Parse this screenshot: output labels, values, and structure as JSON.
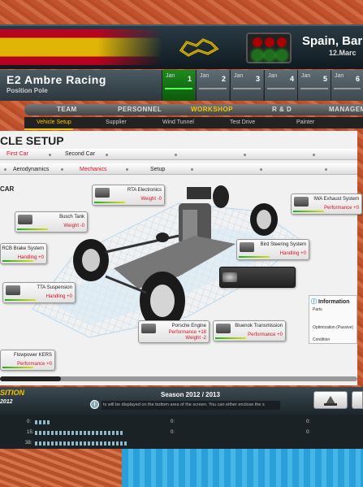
{
  "header": {
    "country": "Spain, Bar",
    "date": "12.Marc"
  },
  "team": {
    "name": "E2 Ambre Racing",
    "position": "Position Pole"
  },
  "calendar": [
    {
      "month": "Jan",
      "num": "1",
      "active": true
    },
    {
      "month": "Jan",
      "num": "2",
      "active": false
    },
    {
      "month": "Jan",
      "num": "3",
      "active": false
    },
    {
      "month": "Jan",
      "num": "4",
      "active": false
    },
    {
      "month": "Jan",
      "num": "5",
      "active": false
    },
    {
      "month": "Jan",
      "num": "6",
      "active": false
    }
  ],
  "nav": {
    "items": [
      "TEAM",
      "PERSONNEL",
      "WORKSHOP",
      "R & D",
      "MANAGEM"
    ],
    "active": "WORKSHOP"
  },
  "subnav": {
    "items": [
      "Vehicle Setup",
      "Supplier",
      "Wind Tunnel",
      "Test Drive",
      "Painter"
    ],
    "active": "Vehicle Setup"
  },
  "page": {
    "title": "CLE SETUP",
    "car_tabs": [
      "First Car",
      "Second Car"
    ],
    "setup_tabs": [
      "Aerodynamics",
      "Mechanics",
      "Setup"
    ],
    "section": "CAR"
  },
  "parts": [
    {
      "name": "RTA Electronics",
      "stat": "Weight -0"
    },
    {
      "name": "IWA Exhaust System",
      "stat": "Performance +0"
    },
    {
      "name": "Busch Tank",
      "stat": "Weight -0"
    },
    {
      "name": "Bird Steering System",
      "stat": "Handling +0"
    },
    {
      "name": "RCB Brake System",
      "stat": "Handling +0"
    },
    {
      "name": "TTA Suspension",
      "stat": "Handling +0"
    },
    {
      "name": "Porsche Engine",
      "stat": "Performance +18",
      "stat2": "Weight -2"
    },
    {
      "name": "Bluenok Transmission",
      "stat": "Performance +0"
    },
    {
      "name": "Flowpower KERS",
      "stat": "Performance +0"
    }
  ],
  "info": {
    "title": "Information",
    "rows": [
      "Parts",
      "Optimization (Passive)",
      "Condition"
    ]
  },
  "footer": {
    "logo": "SITION",
    "logo_year": "2012",
    "season": "Season 2012 / 2013",
    "ticker": "ts will be displayed on the bottom area of the screen. You can either enclose the s",
    "info_icon": "i"
  },
  "stats": [
    {
      "label": "0:",
      "value": "0:"
    },
    {
      "label": "15:",
      "value": "0:"
    },
    {
      "label": "38:",
      "value": ""
    }
  ],
  "colors": {
    "accent": "#f6c400",
    "red": "#d11122",
    "panel": "#f1f1f1"
  }
}
